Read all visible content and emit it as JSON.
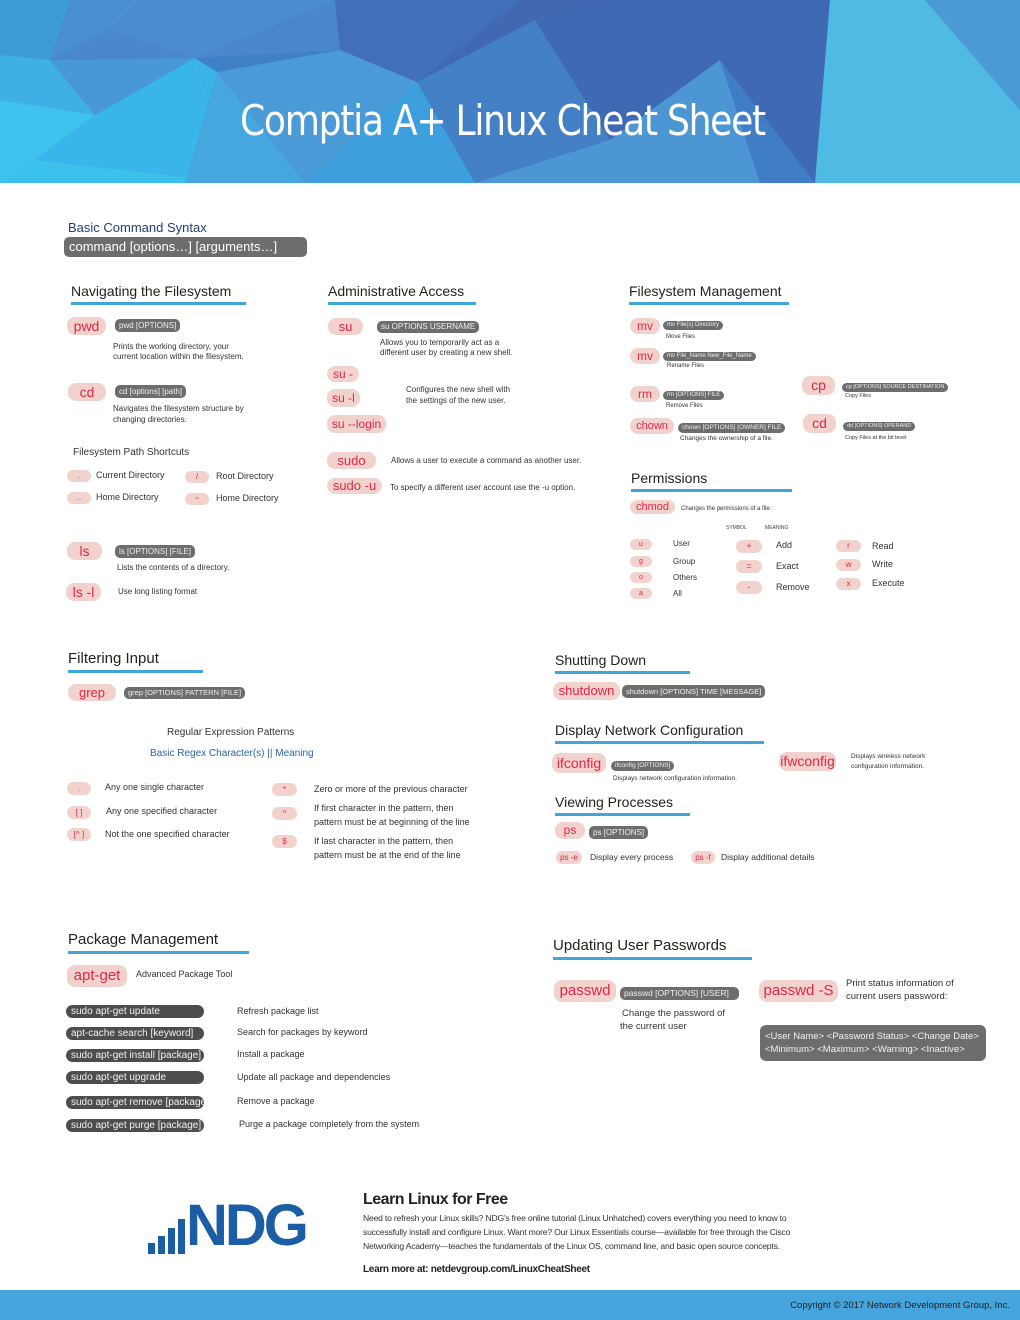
{
  "header": {
    "title": "Comptia A+ Linux Cheat Sheet",
    "colors": {
      "dark_blue": "#3f67b0",
      "mid_blue": "#4a8fd0",
      "light_blue": "#3fbde9"
    }
  },
  "syntax": {
    "title": "Basic Command Syntax",
    "command": "command [options…] [arguments…]"
  },
  "navigating": {
    "title": "Navigating the Filesystem",
    "pwd": {
      "cmd": "pwd",
      "syntax": "pwd [OPTIONS]",
      "desc1": "Prints the working directory, your",
      "desc2": "current location within the filesystem."
    },
    "cd": {
      "cmd": "cd",
      "syntax": "cd [options] [path]",
      "desc1": "Navigates the filesystem structure by",
      "desc2": "changing directories."
    },
    "shortcuts_title": "Filesystem Path Shortcuts",
    "shortcuts": [
      {
        "symbol": ".",
        "label": "Current Directory"
      },
      {
        "symbol": "/",
        "label": "Root Directory"
      },
      {
        "symbol": "..",
        "label": "Home Directory"
      },
      {
        "symbol": "~",
        "label": "Home Directory"
      }
    ],
    "ls": {
      "cmd": "ls",
      "syntax": "ls [OPTIONS] [FILE]",
      "desc": "Lists the contents of a directory."
    },
    "ls_l": {
      "cmd": "ls -l",
      "desc": "Use long listing format"
    }
  },
  "admin": {
    "title": "Administrative Access",
    "su": {
      "cmd": "su",
      "syntax": "su OPTIONS USERNAME",
      "desc1": "Allows you to temporarily act as a",
      "desc2": "different user by creating a new shell."
    },
    "su_variants": [
      "su -",
      "su -l",
      "su --login"
    ],
    "su_variants_desc1": "Configures the new shell with",
    "su_variants_desc2": "the settings of the new user.",
    "sudo": {
      "cmd": "sudo",
      "desc": "Allows a user to execute a command as another user."
    },
    "sudo_u": {
      "cmd": "sudo -u",
      "desc": "To specify a different user account use the -u option."
    }
  },
  "fsmgmt": {
    "title": "Filesystem Management",
    "mv1": {
      "cmd": "mv",
      "syntax": "mv File(s) Directory",
      "desc": "Move Files"
    },
    "mv2": {
      "cmd": "mv",
      "syntax": "mv File_Name New_File_Name",
      "desc": "Rename Files"
    },
    "rm": {
      "cmd": "rm",
      "syntax": "rm [OPTIONS] FILE",
      "desc": "Remove Files"
    },
    "chown": {
      "cmd": "chown",
      "syntax": "chown [OPTIONS] [OWNER] FILE",
      "desc": "Changes the ownership of a file."
    },
    "cp": {
      "cmd": "cp",
      "syntax": "cp [OPTIONS] SOURCE DESTINATION",
      "desc": "Copy Files"
    },
    "dd": {
      "cmd": "cd",
      "syntax": "dd [OPTIONS] OPERAND",
      "desc": "Copy Files at the bit level"
    }
  },
  "permissions": {
    "title": "Permissions",
    "chmod": {
      "cmd": "chmod",
      "desc": "Changes the permissions of a file."
    },
    "symbol_header": "SYMBOL",
    "meaning_header": "MEANING",
    "who": [
      {
        "symbol": "u",
        "label": "User"
      },
      {
        "symbol": "g",
        "label": "Group"
      },
      {
        "symbol": "o",
        "label": "Others"
      },
      {
        "symbol": "a",
        "label": "All"
      }
    ],
    "ops": [
      {
        "symbol": "+",
        "label": "Add"
      },
      {
        "symbol": "=",
        "label": "Exact"
      },
      {
        "symbol": "-",
        "label": "Remove"
      }
    ],
    "perms": [
      {
        "symbol": "r",
        "label": "Read"
      },
      {
        "symbol": "w",
        "label": "Write"
      },
      {
        "symbol": "x",
        "label": "Execute"
      }
    ]
  },
  "filtering": {
    "title": "Filtering Input",
    "grep": {
      "cmd": "grep",
      "syntax": "grep [OPTIONS] PATTERN [FILE]"
    },
    "regex_title": "Regular Expression Patterns",
    "regex_subtitle": "Basic Regex Character(s) || Meaning",
    "left": [
      {
        "symbol": ".",
        "meaning": "Any one single character"
      },
      {
        "symbol": "[ ]",
        "meaning": "Any one specified character"
      },
      {
        "symbol": "[^ ]",
        "meaning": "Not the one specified character"
      }
    ],
    "right": [
      {
        "symbol": "*",
        "meaning1": "Zero or more of the previous character",
        "meaning2": ""
      },
      {
        "symbol": "^",
        "meaning1": "If first character in the pattern, then",
        "meaning2": "pattern must be at beginning of the line"
      },
      {
        "symbol": "$",
        "meaning1": "If last character in the pattern, then",
        "meaning2": "pattern must be at the end of the line"
      }
    ]
  },
  "shutdown": {
    "title": "Shutting Down",
    "cmd": "shutdown",
    "syntax": "shutdown [OPTIONS] TIME [MESSAGE]"
  },
  "network": {
    "title": "Display Network Configuration",
    "ifconfig": {
      "cmd": "ifconfig",
      "syntax": "ifconfig [OPTIONS]",
      "desc": "Displays network configuration information."
    },
    "ifwconfig": {
      "cmd": "ifwconfig",
      "desc1": "Displays wireless network",
      "desc2": "configuration information."
    }
  },
  "processes": {
    "title": "Viewing Processes",
    "ps": {
      "cmd": "ps",
      "syntax": "ps [OPTIONS]"
    },
    "ps_e": {
      "cmd": "ps -e",
      "desc": "Display every process"
    },
    "ps_f": {
      "cmd": "ps -f",
      "desc": "Display additional details"
    }
  },
  "packages": {
    "title": "Package Management",
    "aptget": {
      "cmd": "apt-get",
      "desc": "Advanced Package Tool"
    },
    "rows": [
      {
        "cmd": "sudo apt-get update",
        "desc": "Refresh package list"
      },
      {
        "cmd": "apt-cache search [keyword]",
        "desc": "Search for packages by keyword"
      },
      {
        "cmd": "sudo apt-get install [package]",
        "desc": "Install a package"
      },
      {
        "cmd": "sudo apt-get upgrade",
        "desc": "Update all package and dependencies"
      },
      {
        "cmd": "sudo apt-get remove [package]",
        "desc": "Remove a package"
      },
      {
        "cmd": "sudo apt-get purge [package]",
        "desc": "Purge a package completely from the system"
      }
    ]
  },
  "passwords": {
    "title": "Updating User Passwords",
    "passwd": {
      "cmd": "passwd",
      "syntax": "passwd [OPTIONS] [USER]",
      "desc1": "Change the password of",
      "desc2": "the current user"
    },
    "passwd_s": {
      "cmd": "passwd -S",
      "desc1": "Print status information of",
      "desc2": "current users password:"
    },
    "status_line1": "<User Name> <Password Status> <Change Date>",
    "status_line2": "<Minimum> <Maximum> <Warning> <Inactive>"
  },
  "promo": {
    "logo": "NDG",
    "title": "Learn Linux for Free",
    "body1": "Need to refresh your Linux skills? NDG's free online tutorial (Linux Unhatched) covers everything you need to know to",
    "body2": "successfully install and configure Linux. Want more? Our Linux Essentials course—available for free through the Cisco",
    "body3": "Networking Academy—teaches the fundamentals of the Linux OS, command line, and basic open source concepts.",
    "link": "Learn more at: netdevgroup.com/LinuxCheatSheet",
    "logo_color": "#1b5ea6"
  },
  "footer": {
    "copyright": "Copyright © 2017 Network Development Group, Inc."
  }
}
